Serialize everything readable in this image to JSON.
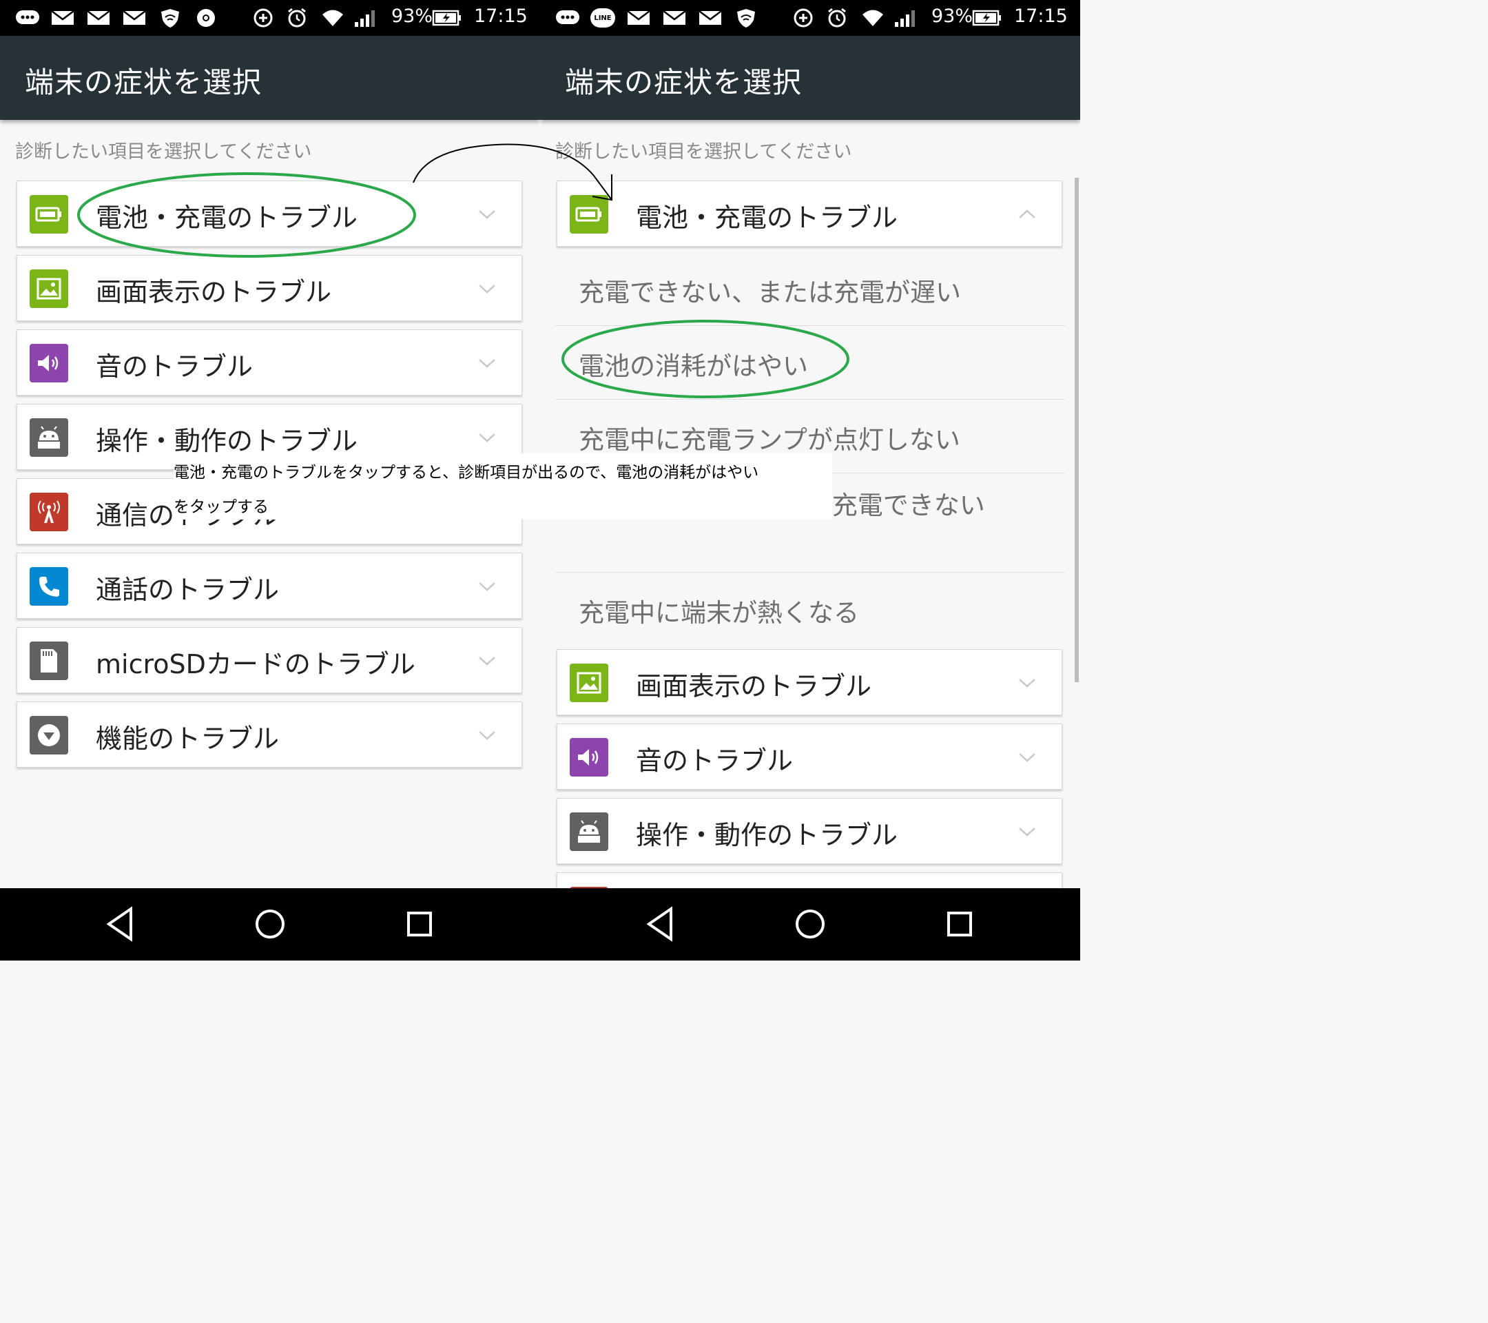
{
  "status_bar": {
    "left": {
      "battery_percent": "93%",
      "time": "17:15"
    },
    "right": {
      "battery_percent": "93%",
      "time": "17:15",
      "line_badge": "LINE"
    }
  },
  "app_bar": {
    "title": "端末の症状を選択"
  },
  "instructions": "診断したい項目を選択してください",
  "left_list": [
    {
      "label": "電池・充電のトラブル",
      "icon": "battery-icon"
    },
    {
      "label": "画面表示のトラブル",
      "icon": "picture-icon"
    },
    {
      "label": "音のトラブル",
      "icon": "speaker-icon"
    },
    {
      "label": "操作・動作のトラブル",
      "icon": "android-icon"
    },
    {
      "label": "通信のトラブル",
      "icon": "antenna-icon"
    },
    {
      "label": "通話のトラブル",
      "icon": "phone-icon"
    },
    {
      "label": "microSDカードのトラブル",
      "icon": "sdcard-icon"
    },
    {
      "label": "機能のトラブル",
      "icon": "dropdown-icon"
    }
  ],
  "right_list": {
    "expanded_category": {
      "label": "電池・充電のトラブル",
      "icon": "battery-icon"
    },
    "sub_items": [
      "充電できない、または充電が遅い",
      "電池の消耗がはやい",
      "充電中に充電ランプが点灯しない",
      "充電ランプが点滅して充電できない",
      "充電中に端末が熱くなる"
    ],
    "collapsed": [
      {
        "label": "画面表示のトラブル",
        "icon": "picture-icon"
      },
      {
        "label": "音のトラブル",
        "icon": "speaker-icon"
      },
      {
        "label": "操作・動作のトラブル",
        "icon": "android-icon"
      }
    ]
  },
  "annotation": {
    "line1": "電池・充電のトラブルをタップすると、診断項目が出るので、電池の消耗がはやい",
    "line2": "をタップする"
  },
  "colors": {
    "app_bar": "#263238",
    "highlight": "#2aa84a",
    "battery": "#7cb518",
    "speaker": "#8e44ad",
    "antenna": "#c0392b",
    "phone": "#0288d1",
    "gray_icon": "#616161"
  }
}
